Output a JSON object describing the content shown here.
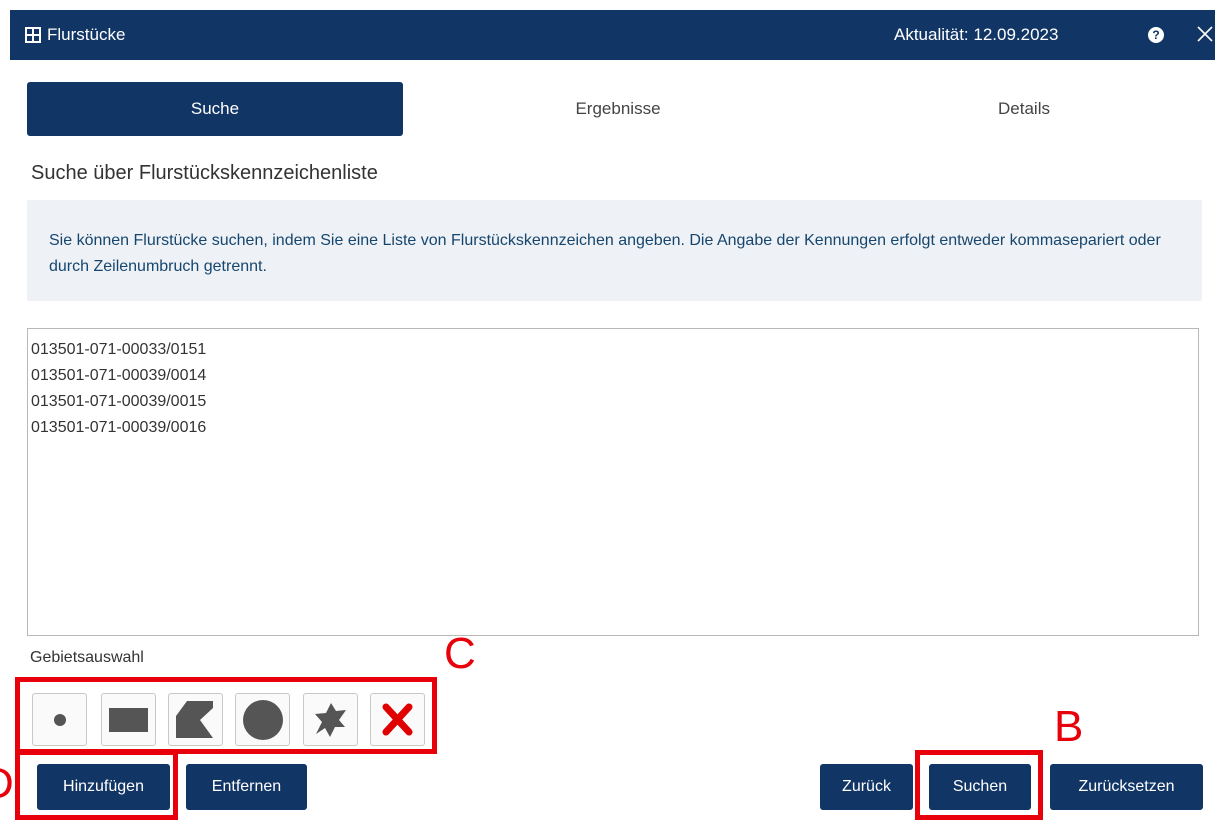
{
  "window": {
    "title": "Flurstücke",
    "date": "Aktualität: 12.09.2023",
    "help_symbol": "?",
    "icons": [
      "table-grid-icon",
      "help-circle-icon",
      "close-icon"
    ]
  },
  "tabs": [
    {
      "label": "Suche",
      "active": true
    },
    {
      "label": "Ergebnisse",
      "active": false
    },
    {
      "label": "Details",
      "active": false
    }
  ],
  "section": {
    "heading": "Suche über Flurstückskennzeichenliste",
    "info": "Sie können Flurstücke suchen, indem Sie eine Liste von Flurstückskennzeichen angeben. Die Angabe der Kennungen erfolgt entweder kommasepariert oder durch Zeilenumbruch getrennt."
  },
  "identifiers": [
    "013501-071-00033/0151",
    "013501-071-00039/0014",
    "013501-071-00039/0015",
    "013501-071-00039/0016"
  ],
  "area_selection": {
    "label": "Gebietsauswahl",
    "tools": [
      "point-icon",
      "rectangle-icon",
      "polygon-icon",
      "circle-icon",
      "freehand-icon",
      "delete-x-icon"
    ]
  },
  "buttons": {
    "add": "Hinzufügen",
    "remove": "Entfernen",
    "back": "Zurück",
    "search": "Suchen",
    "reset": "Zurücksetzen"
  },
  "annotations": {
    "c": "C",
    "b": "B",
    "d": "D"
  },
  "colors": {
    "primary": "#113565",
    "highlight": "#e8000a",
    "delete": "#e00000"
  }
}
